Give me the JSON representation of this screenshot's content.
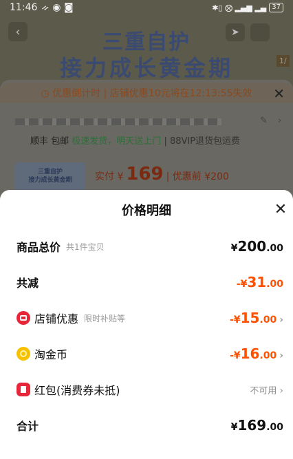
{
  "status_bar": {
    "time": "11:46",
    "left_icons": "ᨀ ◉ ◙",
    "right_icons": "✱▯ ⨂ ▂▄▆ ▂▄",
    "battery": "37"
  },
  "banner": {
    "line1": "三重自护",
    "line2": "接力成长黄金期",
    "side_tag": "1/"
  },
  "order": {
    "countdown": "◷ 优惠倒计时 | 店铺优惠10元将在12:13:55失效",
    "shipping_carrier": "顺丰 包邮",
    "shipping_speed": "极速发货，明天送上门",
    "shipping_extra": "| 88VIP退货包运费",
    "thumb_text": "三重自护\n接力成长黄金期",
    "price_label": "实付 ¥",
    "price_value": "169",
    "price_before": "| 优惠前 ¥200"
  },
  "sheet": {
    "title": "价格明细",
    "rows": {
      "total": {
        "label": "商品总价",
        "sub": "共1件宝贝",
        "cur": "¥",
        "int": "200",
        "dec": ".00"
      },
      "reduce": {
        "label": "共减",
        "cur": "-¥",
        "int": "31",
        "dec": ".00"
      },
      "shop": {
        "label": "店铺优惠",
        "sub": "限时补贴等",
        "cur": "-¥",
        "int": "15",
        "dec": ".00",
        "icon": "shop-icon"
      },
      "coin": {
        "label": "淘金币",
        "cur": "-¥",
        "int": "16",
        "dec": ".00",
        "icon": "coin-icon"
      },
      "redpacket": {
        "label": "红包(消费券未抵)",
        "value": "不可用",
        "icon": "red-packet-icon"
      },
      "sum": {
        "label": "合计",
        "cur": "¥",
        "int": "169",
        "dec": ".00"
      }
    }
  },
  "colors": {
    "accent": "#ff5000",
    "shop_icon": "#e8263a",
    "coin_icon": "#f7c100"
  }
}
